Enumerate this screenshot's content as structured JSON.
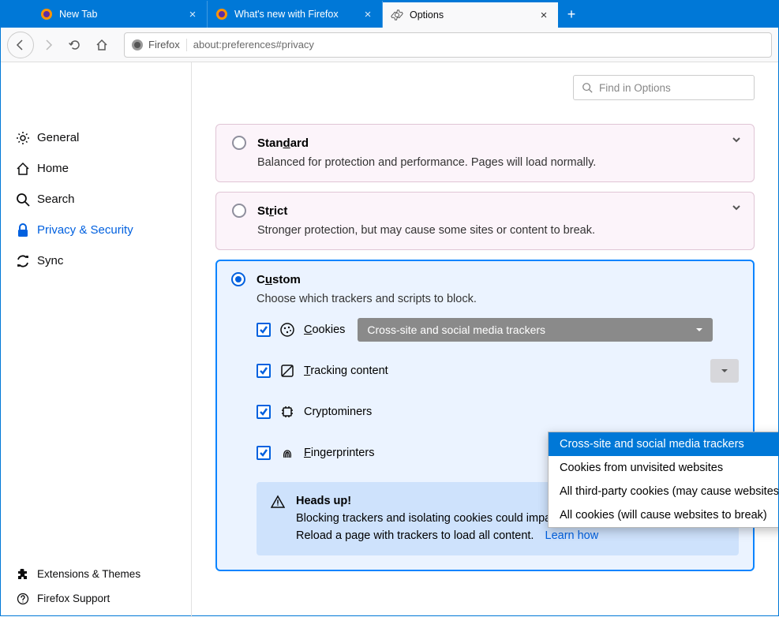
{
  "tabs": [
    {
      "label": "New Tab"
    },
    {
      "label": "What's new with Firefox"
    },
    {
      "label": "Options"
    }
  ],
  "url": {
    "identity": "Firefox",
    "address": "about:preferences#privacy"
  },
  "sidebar": {
    "items": [
      {
        "label": "General"
      },
      {
        "label": "Home"
      },
      {
        "label": "Search"
      },
      {
        "label": "Privacy & Security"
      },
      {
        "label": "Sync"
      }
    ],
    "bottom": [
      {
        "label": "Extensions & Themes"
      },
      {
        "label": "Firefox Support"
      }
    ]
  },
  "search_placeholder": "Find in Options",
  "cards": {
    "standard": {
      "title_pre": "Stan",
      "title_ul": "d",
      "title_post": "ard",
      "desc": "Balanced for protection and performance. Pages will load normally."
    },
    "strict": {
      "title_pre": "St",
      "title_ul": "r",
      "title_post": "ict",
      "desc": "Stronger protection, but may cause some sites or content to break."
    },
    "custom": {
      "title_pre": "C",
      "title_ul": "u",
      "title_post": "stom",
      "desc": "Choose which trackers and scripts to block.",
      "options": {
        "cookies_pre": "",
        "cookies_ul": "C",
        "cookies_post": "ookies",
        "cookies_select": "Cross-site and social media trackers",
        "tracking_pre": "",
        "tracking_ul": "T",
        "tracking_post": "racking content",
        "crypto": "Cryptominers",
        "finger_pre": "",
        "finger_ul": "F",
        "finger_post": "ingerprinters"
      },
      "dropdown": [
        "Cross-site and social media trackers",
        "Cookies from unvisited websites",
        "All third-party cookies (may cause websites to break)",
        "All cookies (will cause websites to break)"
      ],
      "notice": {
        "title": "Heads up!",
        "body": "Blocking trackers and isolating cookies could impact the functionality of some sites. Reload a page with trackers to load all content.",
        "link": "Learn how"
      }
    }
  }
}
